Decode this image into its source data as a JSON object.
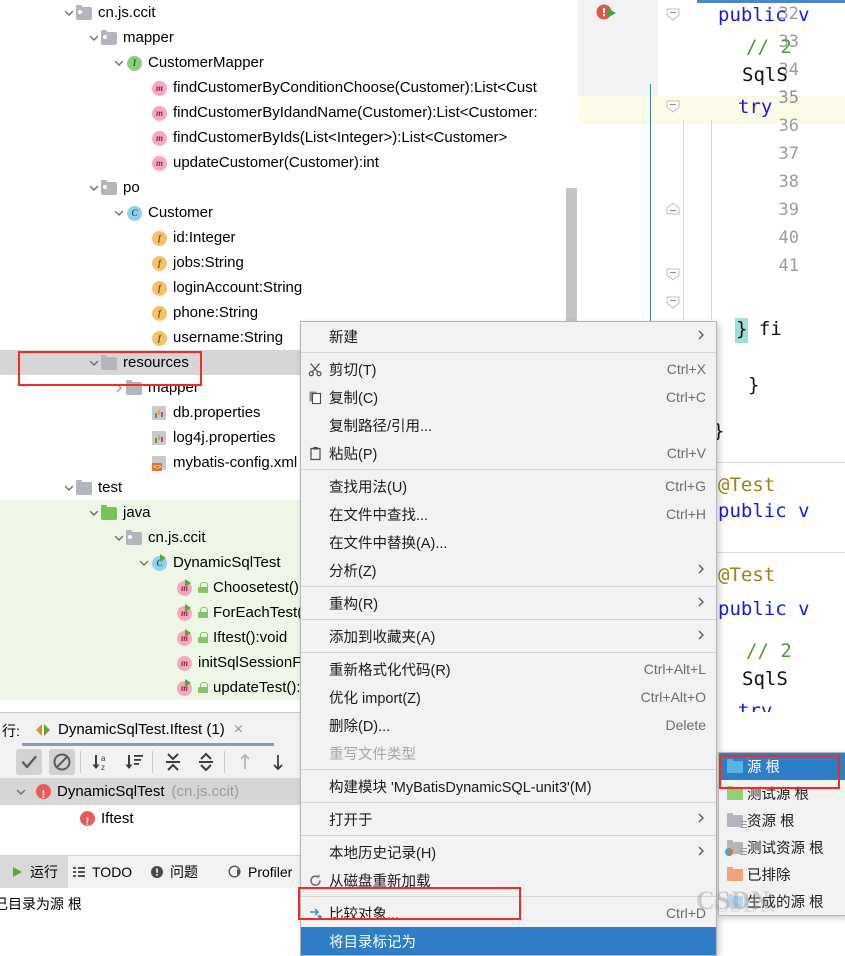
{
  "project_tree": {
    "nodes": [
      {
        "label": "cn.js.ccit",
        "indent": 0,
        "icon": "package-folder-icon",
        "chev": "down"
      },
      {
        "label": "mapper",
        "indent": 1,
        "icon": "package-folder-icon",
        "chev": "down"
      },
      {
        "label": "CustomerMapper",
        "indent": 2,
        "icon": "interface-icon",
        "chev": "down"
      },
      {
        "label": "findCustomerByConditionChoose(Customer):List<Cust",
        "indent": 3,
        "icon": "method-icon",
        "chev": "none"
      },
      {
        "label": "findCustomerByIdandName(Customer):List<Customer:",
        "indent": 3,
        "icon": "method-icon",
        "chev": "none"
      },
      {
        "label": "findCustomerByIds(List<Integer>):List<Customer>",
        "indent": 3,
        "icon": "method-icon",
        "chev": "none"
      },
      {
        "label": "updateCustomer(Customer):int",
        "indent": 3,
        "icon": "method-icon",
        "chev": "none"
      },
      {
        "label": "po",
        "indent": 1,
        "icon": "package-folder-icon",
        "chev": "down"
      },
      {
        "label": "Customer",
        "indent": 2,
        "icon": "class-icon",
        "chev": "down"
      },
      {
        "label": "id:Integer",
        "indent": 3,
        "icon": "field-icon",
        "chev": "none"
      },
      {
        "label": "jobs:String",
        "indent": 3,
        "icon": "field-icon",
        "chev": "none"
      },
      {
        "label": "loginAccount:String",
        "indent": 3,
        "icon": "field-icon",
        "chev": "none"
      },
      {
        "label": "phone:String",
        "indent": 3,
        "icon": "field-icon",
        "chev": "none"
      },
      {
        "label": "username:String",
        "indent": 3,
        "icon": "field-icon",
        "chev": "none"
      },
      {
        "label": "resources",
        "indent": 1,
        "icon": "folder-icon",
        "chev": "down",
        "selected": true
      },
      {
        "label": "mapper",
        "indent": 2,
        "icon": "folder-icon",
        "chev": "right"
      },
      {
        "label": "db.properties",
        "indent": 3,
        "icon": "properties-file-icon",
        "chev": "none"
      },
      {
        "label": "log4j.properties",
        "indent": 3,
        "icon": "properties-file-icon",
        "chev": "none"
      },
      {
        "label": "mybatis-config.xml",
        "indent": 3,
        "icon": "xml-file-icon",
        "chev": "none"
      },
      {
        "label": "test",
        "indent": 0,
        "icon": "folder-icon",
        "chev": "down"
      },
      {
        "label": "java",
        "indent": 1,
        "icon": "test-source-folder-icon",
        "chev": "down",
        "green": true
      },
      {
        "label": "cn.js.ccit",
        "indent": 2,
        "icon": "package-folder-icon",
        "chev": "down",
        "green": true
      },
      {
        "label": "DynamicSqlTest",
        "indent": 3,
        "icon": "test-class-icon",
        "chev": "down",
        "green": true
      },
      {
        "label": "Choosetest():void",
        "indent": 4,
        "icon": "test-method-icon",
        "chev": "none",
        "green": true,
        "lock": true
      },
      {
        "label": "ForEachTest():void",
        "indent": 4,
        "icon": "test-method-icon",
        "chev": "none",
        "green": true,
        "lock": true
      },
      {
        "label": "Iftest():void",
        "indent": 4,
        "icon": "test-method-icon",
        "chev": "none",
        "green": true,
        "lock": true
      },
      {
        "label": "initSqlSessionFactory",
        "indent": 4,
        "icon": "method-icon",
        "chev": "none",
        "green": true
      },
      {
        "label": "updateTest():void",
        "indent": 4,
        "icon": "test-method-icon",
        "chev": "none",
        "green": true,
        "lock": true
      }
    ]
  },
  "editor": {
    "line_numbers": [
      "32",
      "33",
      "34",
      "35",
      "36",
      "37",
      "38",
      "39",
      "40",
      "41"
    ],
    "current_line": "35",
    "code_lines": [
      {
        "text": "public v",
        "cls": "kw"
      },
      {
        "text": "// 2",
        "cls": "cmt"
      },
      {
        "text": "SqlS",
        "cls": "plain"
      },
      {
        "text": "try",
        "cls": "kw"
      },
      {
        "text": "} fi",
        "cls": "plain"
      },
      {
        "text": "}",
        "cls": "plain"
      },
      {
        "text": "}",
        "cls": "plain"
      },
      {
        "text": "@Test",
        "cls": "anno"
      },
      {
        "text": "public v",
        "cls": "kw"
      },
      {
        "text": "@Test",
        "cls": "anno"
      },
      {
        "text": "public v",
        "cls": "kw"
      },
      {
        "text": "// 2",
        "cls": "cmt"
      },
      {
        "text": "SqlS",
        "cls": "plain"
      },
      {
        "text": "try",
        "cls": "kw"
      }
    ]
  },
  "run_panel": {
    "run_label": "行:",
    "tab_title": "DynamicSqlTest.Iftest (1)",
    "close_label": "×",
    "toolbar_icons": [
      "show-passed-icon",
      "hide-ignored-icon",
      "sort-alphabetically-icon",
      "sort-by-duration-icon",
      "expand-all-icon",
      "collapse-all-icon",
      "previous-failed-icon",
      "next-failed-icon"
    ],
    "tree": [
      {
        "label": "DynamicSqlTest",
        "suffix": "(cn.js.ccit)",
        "status": "failed",
        "indent": 0,
        "chev": "down"
      },
      {
        "label": "Iftest",
        "suffix": "",
        "status": "failed",
        "indent": 1,
        "chev": "none"
      }
    ],
    "bottom_tabs": [
      {
        "label": "运行",
        "icon": "run-icon",
        "selected": true
      },
      {
        "label": "TODO",
        "icon": "todo-icon",
        "selected": false
      },
      {
        "label": "问题",
        "icon": "problems-icon",
        "selected": false
      },
      {
        "label": "Profiler",
        "icon": "profiler-icon",
        "selected": false
      }
    ]
  },
  "status_bar": {
    "text": "己目录为源 根"
  },
  "context_menu": {
    "items": [
      {
        "label": "新建",
        "accel": "",
        "icon": "",
        "arrow": true,
        "sep_after": true
      },
      {
        "label": "剪切(T)",
        "accel": "Ctrl+X",
        "icon": "scissors-icon",
        "arrow": false
      },
      {
        "label": "复制(C)",
        "accel": "Ctrl+C",
        "icon": "copy-icon",
        "arrow": false
      },
      {
        "label": "复制路径/引用...",
        "accel": "",
        "icon": "",
        "arrow": false
      },
      {
        "label": "粘贴(P)",
        "accel": "Ctrl+V",
        "icon": "clipboard-icon",
        "arrow": false,
        "sep_after": true
      },
      {
        "label": "查找用法(U)",
        "accel": "Ctrl+G",
        "icon": "",
        "arrow": false
      },
      {
        "label": "在文件中查找...",
        "accel": "Ctrl+H",
        "icon": "",
        "arrow": false
      },
      {
        "label": "在文件中替换(A)...",
        "accel": "",
        "icon": "",
        "arrow": false
      },
      {
        "label": "分析(Z)",
        "accel": "",
        "icon": "",
        "arrow": true,
        "sep_after": true
      },
      {
        "label": "重构(R)",
        "accel": "",
        "icon": "",
        "arrow": true,
        "sep_after": true
      },
      {
        "label": "添加到收藏夹(A)",
        "accel": "",
        "icon": "",
        "arrow": true,
        "sep_after": true
      },
      {
        "label": "重新格式化代码(R)",
        "accel": "Ctrl+Alt+L",
        "icon": "",
        "arrow": false
      },
      {
        "label": "优化 import(Z)",
        "accel": "Ctrl+Alt+O",
        "icon": "",
        "arrow": false
      },
      {
        "label": "删除(D)...",
        "accel": "Delete",
        "icon": "",
        "arrow": false
      },
      {
        "label": "重写文件类型",
        "accel": "",
        "icon": "",
        "arrow": false,
        "disabled": true,
        "sep_after": true
      },
      {
        "label": "构建模块 'MyBatisDynamicSQL-unit3'(M)",
        "accel": "",
        "icon": "",
        "arrow": false,
        "sep_after": true
      },
      {
        "label": "打开于",
        "accel": "",
        "icon": "",
        "arrow": true,
        "sep_after": true
      },
      {
        "label": "本地历史记录(H)",
        "accel": "",
        "icon": "",
        "arrow": true
      },
      {
        "label": "从磁盘重新加载",
        "accel": "",
        "icon": "refresh-icon",
        "arrow": false,
        "sep_after": true
      },
      {
        "label": "比较对象...",
        "accel": "Ctrl+D",
        "icon": "compare-icon",
        "arrow": false
      },
      {
        "label": "将目录标记为",
        "accel": "",
        "icon": "",
        "arrow": false,
        "highlight": true
      }
    ]
  },
  "sub_menu": {
    "items": [
      {
        "label": "源 根",
        "icon": "sources-root-icon",
        "color": "#56b6e0",
        "highlight": true
      },
      {
        "label": "测试源 根",
        "icon": "test-sources-root-icon",
        "color": "#8cd172"
      },
      {
        "label": "资源 根",
        "icon": "resources-root-icon",
        "color": "#b2b5bb"
      },
      {
        "label": "测试资源 根",
        "icon": "test-resources-root-icon",
        "color": "#b2b5bb"
      },
      {
        "label": "已排除",
        "icon": "excluded-icon",
        "color": "#f0a27a"
      },
      {
        "label": "生成的源 根",
        "icon": "generated-sources-root-icon",
        "color": "#b9d9ee"
      }
    ]
  },
  "watermark": {
    "text": "CSDN"
  },
  "colors": {
    "highlight_blue": "#2d7dc7",
    "annotation_red": "#f5291f",
    "test_source_green": "#eef7e7",
    "selection_gray": "#d6d6d6"
  }
}
